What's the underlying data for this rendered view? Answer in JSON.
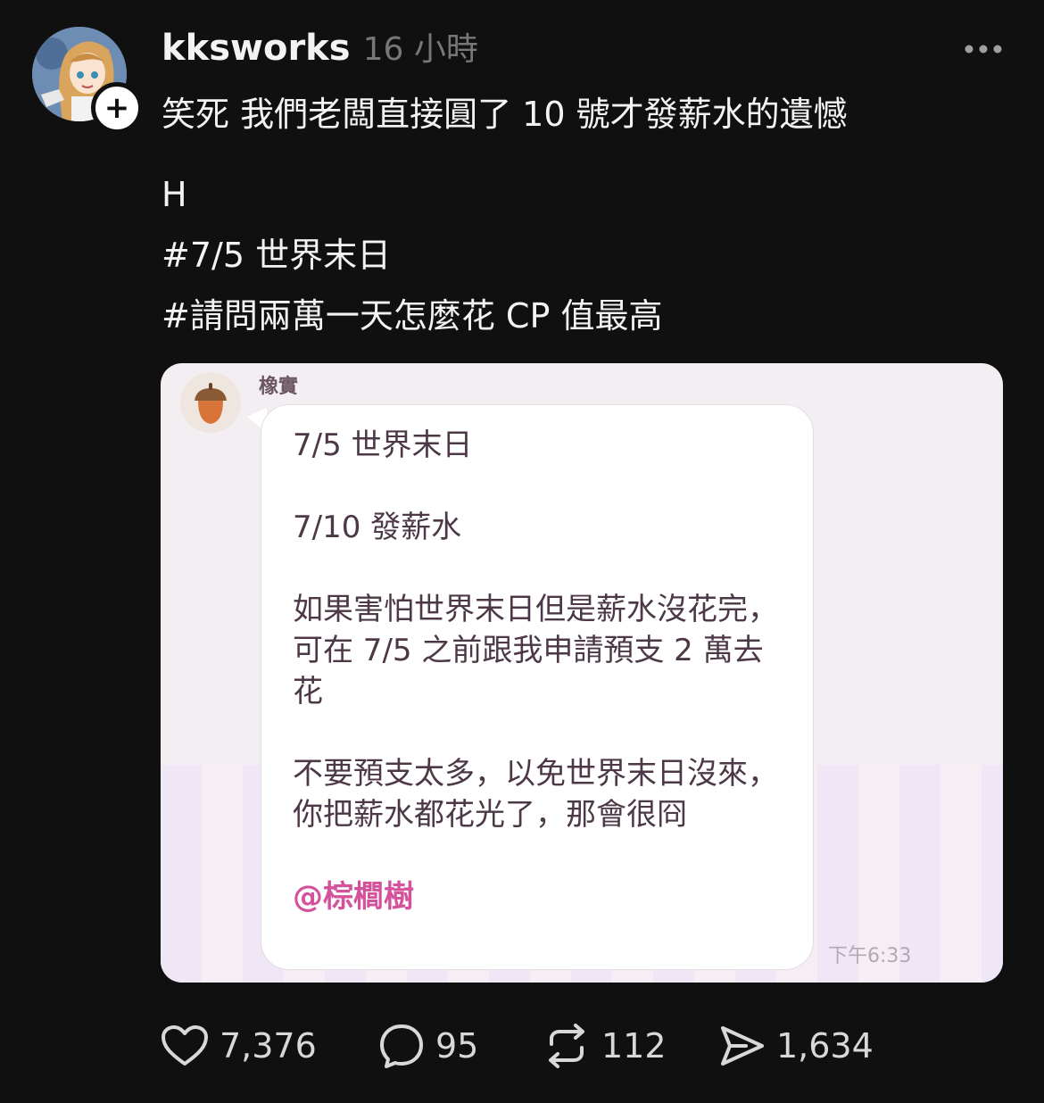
{
  "post": {
    "username": "kksworks",
    "timestamp": "16 小時",
    "more_icon": "more-horizontal-icon",
    "lines": [
      "笑死 我們老闆直接圓了 10 號才發薪水的遺憾",
      "H",
      "#7/5 世界末日",
      "#請問兩萬一天怎麼花 CP 值最高"
    ]
  },
  "chat": {
    "sender": "橡實",
    "para1": "7/5 世界末日",
    "para2": "7/10 發薪水",
    "para3": "如果害怕世界末日但是薪水沒花完，可在 7/5 之前跟我申請預支 2 萬去花",
    "para4": "不要預支太多，以免世界末日沒來，你把薪水都花光了，那會很冏",
    "mention": "@棕櫚樹",
    "time": "下午6:33"
  },
  "actions": {
    "likes": "7,376",
    "comments": "95",
    "reposts": "112",
    "shares": "1,634"
  },
  "colors": {
    "background": "#101010",
    "mention": "#d4519c",
    "timestamp": "#777777"
  }
}
